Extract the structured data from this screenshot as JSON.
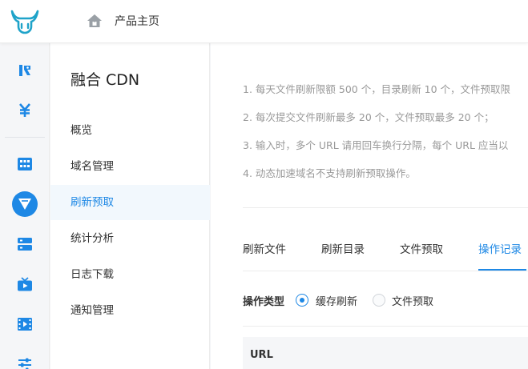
{
  "header": {
    "breadcrumb": "产品主页",
    "logo_icon": "bull-logo-icon",
    "home_icon": "home-icon"
  },
  "rail": {
    "items": [
      {
        "icon": "kodo-icon"
      },
      {
        "icon": "yen-icon"
      },
      {
        "icon": "grid-icon"
      },
      {
        "icon": "cdn-icon",
        "active": true
      },
      {
        "icon": "server-icon"
      },
      {
        "icon": "tv-icon"
      },
      {
        "icon": "video-icon"
      },
      {
        "icon": "sliders-icon"
      }
    ],
    "accent": "#1e88e5"
  },
  "subnav": {
    "title": "融合 CDN",
    "items": [
      {
        "label": "概览"
      },
      {
        "label": "域名管理"
      },
      {
        "label": "刷新预取",
        "active": true
      },
      {
        "label": "统计分析"
      },
      {
        "label": "日志下载"
      },
      {
        "label": "通知管理"
      }
    ]
  },
  "notes": [
    "1. 每天文件刷新限额 500 个，目录刷新 10 个，文件预取限",
    "2. 每次提交文件刷新最多 20 个，文件预取最多 20 个；",
    "3. 输入时，多个 URL 请用回车换行分隔，每个 URL 应当以",
    "4. 动态加速域名不支持刷新预取操作。"
  ],
  "tabs": [
    {
      "label": "刷新文件"
    },
    {
      "label": "刷新目录"
    },
    {
      "label": "文件预取"
    },
    {
      "label": "操作记录",
      "active": true
    }
  ],
  "filter": {
    "label": "操作类型",
    "options": [
      {
        "label": "缓存刷新",
        "checked": true
      },
      {
        "label": "文件预取",
        "checked": false
      }
    ]
  },
  "table": {
    "columns": [
      "URL"
    ]
  }
}
